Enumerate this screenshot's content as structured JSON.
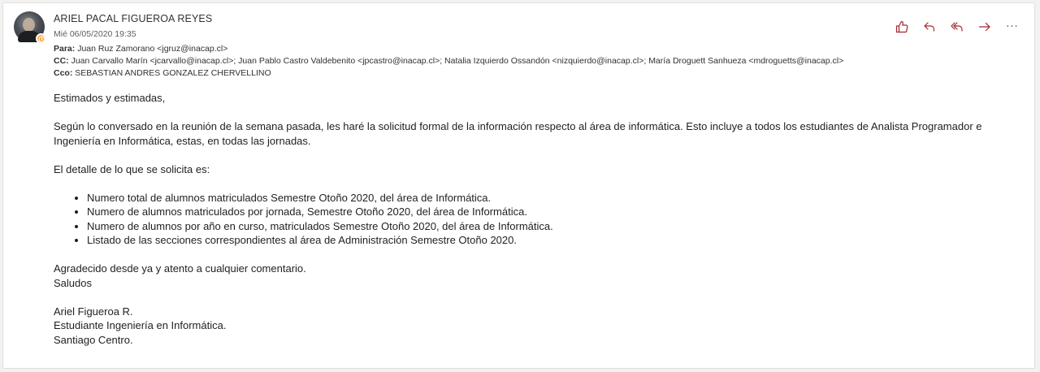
{
  "header": {
    "sender": "ARIEL PACAL FIGUEROA REYES",
    "datetime": "Mié 06/05/2020 19:35",
    "to_label": "Para:",
    "to_value": "Juan Ruz Zamorano <jgruz@inacap.cl>",
    "cc_label": "CC:",
    "cc_value": "Juan Carvallo Marín <jcarvallo@inacap.cl>; Juan Pablo Castro Valdebenito <jpcastro@inacap.cl>; Natalia Izquierdo Ossandón <nizquierdo@inacap.cl>; María Droguett Sanhueza <mdroguetts@inacap.cl>",
    "bcc_label": "Cco:",
    "bcc_value": "SEBASTIAN ANDRES GONZALEZ CHERVELLINO"
  },
  "actions": {
    "icons": [
      "like-icon",
      "reply-icon",
      "reply-all-icon",
      "forward-icon",
      "more-icon"
    ],
    "more_glyph": "···",
    "accent_color": "#a4262c"
  },
  "body": {
    "greeting": "Estimados y estimadas,",
    "paragraph_1": "Según lo conversado en la reunión de la semana pasada, les haré la solicitud formal de la información respecto al área de informática. Esto incluye a todos los estudiantes de Analista Programador e Ingeniería en Informática, estas, en todas las jornadas.",
    "detail_intro": "El detalle de lo que se solicita es:",
    "items": [
      "Numero total de alumnos matriculados Semestre Otoño 2020, del área de Informática.",
      "Numero de alumnos matriculados por jornada, Semestre Otoño 2020, del área de Informática.",
      "Numero de alumnos por año en curso, matriculados Semestre Otoño 2020, del área de Informática.",
      "Listado de las secciones correspondientes al área de Administración Semestre Otoño 2020."
    ],
    "closing_1": "Agradecido desde ya y atento a cualquier comentario.",
    "closing_2": "Saludos",
    "signature_name": "Ariel Figueroa R.",
    "signature_title": "Estudiante Ingeniería en Informática.",
    "signature_campus": "Santiago Centro."
  }
}
